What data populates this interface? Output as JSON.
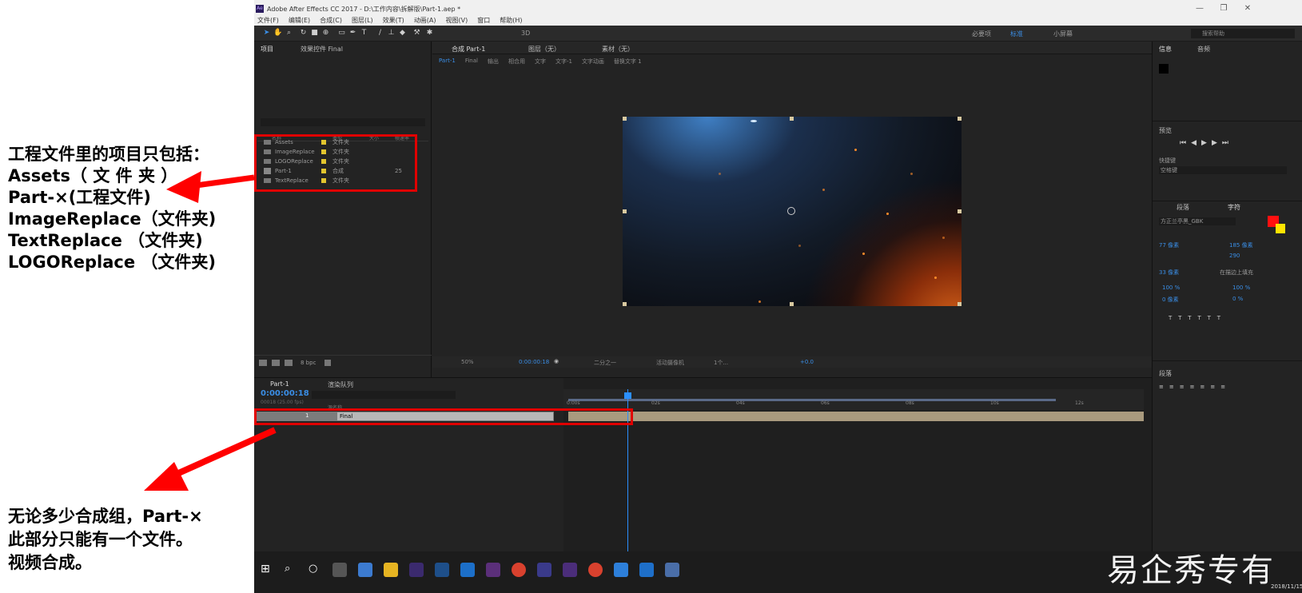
{
  "annotations": {
    "top_lines": [
      "工程文件里的项目只包括：",
      "Assets（ 文 件 夹 ）",
      "Part-×(工程文件)",
      "ImageReplace（文件夹)",
      "TextReplace （文件夹)",
      "LOGOReplace （文件夹)"
    ],
    "bottom_lines": [
      "无论多少合成组，Part-×",
      "此部分只能有一个文件。",
      "视频合成。"
    ],
    "arrow_color": "#ff0000"
  },
  "window": {
    "title": "Adobe After Effects CC 2017 - D:\\工作内容\\拆解版\\Part-1.aep *",
    "menu": [
      "文件(F)",
      "编辑(E)",
      "合成(C)",
      "图层(L)",
      "效果(T)",
      "动画(A)",
      "视图(V)",
      "窗口",
      "帮助(H)"
    ],
    "toolbar_labels": {
      "snap": "3D",
      "workspace_default": "必要项",
      "workspace_standard": "标准",
      "workspace_small": "小屏幕",
      "search_placeholder": "搜索帮助"
    }
  },
  "project_panel": {
    "tab": "项目",
    "effect_controls_tab": "效果控件 Final",
    "columns": {
      "name": "名称",
      "type": "类型",
      "size": "大小",
      "duration": "帧速率"
    },
    "items": [
      {
        "name": "Assets",
        "type": "文件夹",
        "icon": "folder-icon"
      },
      {
        "name": "ImageReplace",
        "type": "文件夹",
        "icon": "folder-icon"
      },
      {
        "name": "LOGOReplace",
        "type": "文件夹",
        "icon": "folder-icon"
      },
      {
        "name": "Part-1",
        "type": "合成",
        "size": "25",
        "icon": "composition-icon"
      },
      {
        "name": "TextReplace",
        "type": "文件夹",
        "icon": "folder-icon"
      }
    ],
    "bpc": "8 bpc"
  },
  "composition_panel": {
    "tabs": [
      "合成 Part-1",
      "图层（无）",
      "素材（无）"
    ],
    "breadcrumbs": [
      "Part-1",
      "Final",
      "输出",
      "相合用",
      "文字",
      "文字-1",
      "文字动画",
      "替换文字 1"
    ],
    "zoom": "50%",
    "timecode": "0:00:00:18",
    "resolution": "二分之一",
    "camera": "活动摄像机",
    "views": "1个...",
    "exposure": "+0.0"
  },
  "right_panel": {
    "info_tab": "信息",
    "audio_tab": "音频",
    "preview_tab": "预览",
    "shortcut_label": "快捷键",
    "shortcut_value": "空格键",
    "paragraph_tab": "段落",
    "character_tab": "字符",
    "font_name": "方正兰亭黑_GBK",
    "text_color": "#ff1010",
    "stroke_color": "#ffe400",
    "size_value": "77 像素",
    "leading_value": "185 像素",
    "tracking_value": "290",
    "stroke_value": "33 像素",
    "stroke_mode": "在描边上填充",
    "vscale": "100 %",
    "hscale": "100 %",
    "baseline": "0 像素",
    "tsume": "0 %",
    "align_tab": "段落"
  },
  "timeline": {
    "tab": "Part-1",
    "render_queue_tab": "渲染队列",
    "timecode": "0:00:00:18",
    "frames": "00018 (25.00 fps)",
    "layer_header": "源名称",
    "layer": {
      "index": "1",
      "name": "Final"
    },
    "ruler_ticks": [
      "0:00s",
      "02s",
      "04s",
      "06s",
      "08s",
      "10s",
      "12s"
    ]
  },
  "watermark": "易企秀专有",
  "date": "2018/11/15"
}
